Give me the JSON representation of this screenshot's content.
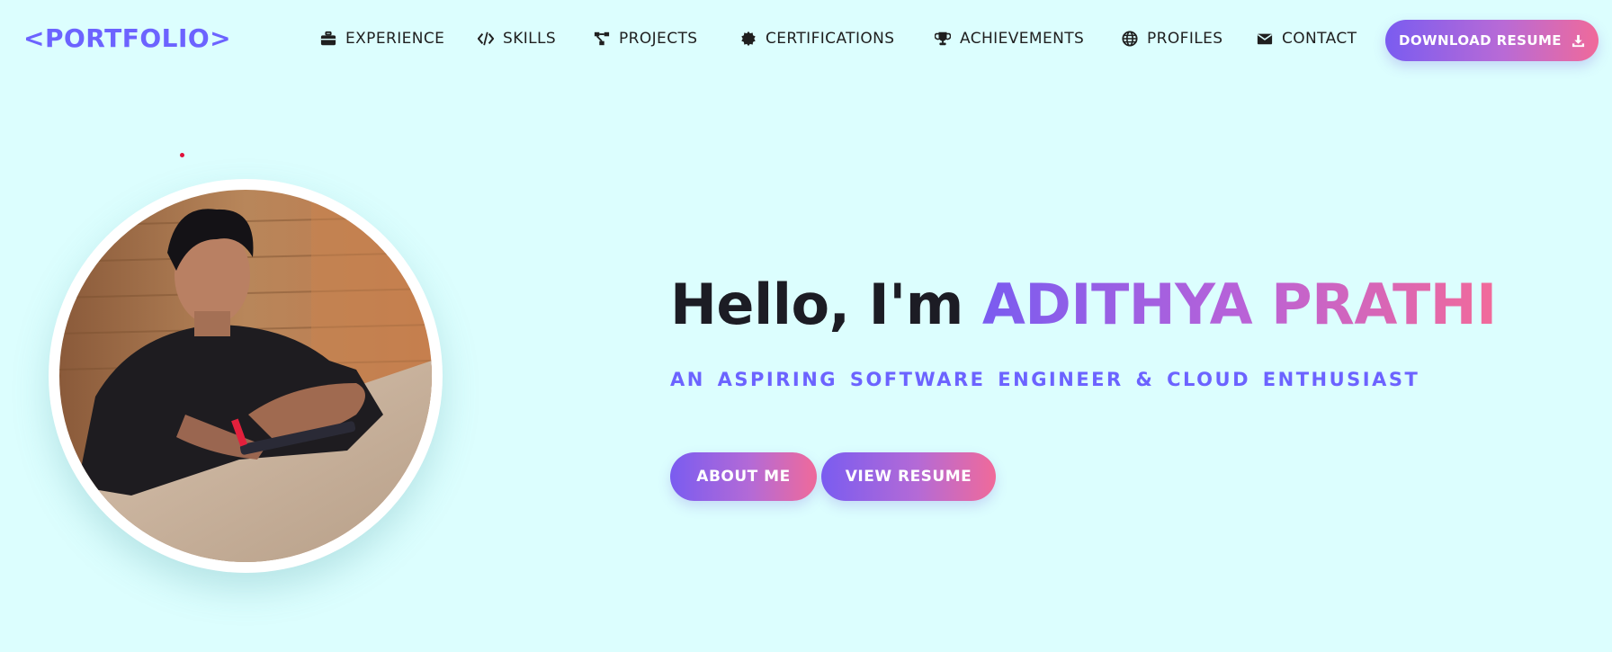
{
  "nav": {
    "logo": "<PORTFOLIO>",
    "items": [
      {
        "label": "EXPERIENCE",
        "icon": "briefcase-icon"
      },
      {
        "label": "SKILLS",
        "icon": "code-icon"
      },
      {
        "label": "PROJECTS",
        "icon": "project-diagram-icon"
      },
      {
        "label": "CERTIFICATIONS",
        "icon": "certificate-icon"
      },
      {
        "label": "ACHIEVEMENTS",
        "icon": "trophy-icon"
      },
      {
        "label": "PROFILES",
        "icon": "globe-icon"
      },
      {
        "label": "CONTACT",
        "icon": "envelope-icon"
      }
    ],
    "download_label": "DOWNLOAD RESUME",
    "download_icon": "download-icon"
  },
  "hero": {
    "greeting": "Hello, I'm",
    "name": "ADITHYA PRATHI",
    "subtitle": "AN ASPIRING SOFTWARE ENGINEER & CLOUD ENTHUSIAST",
    "buttons": [
      {
        "label": "ABOUT ME"
      },
      {
        "label": "VIEW RESUME"
      }
    ]
  },
  "colors": {
    "background": "#dcfefe",
    "accent": "#6c63ff",
    "gradient_start": "#7a5cf0",
    "gradient_end": "#f06a9a"
  }
}
